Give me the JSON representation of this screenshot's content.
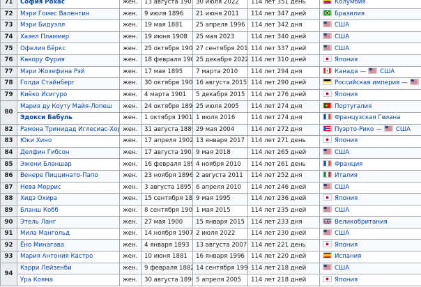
{
  "rows": [
    {
      "rank": "71",
      "name": "София Рохас",
      "bold": true,
      "sex": "жен.",
      "birth": "13 августа 1907",
      "death": "30 июля 2022",
      "age": "114 лет 351 день",
      "country": [
        {
          "flag": "colombia",
          "label": "Колумбия"
        }
      ]
    },
    {
      "rank": "72",
      "name": "Мэри Гомес Валентин",
      "sex": "жен.",
      "birth": "9 июля 1896",
      "death": "21 июня 2011",
      "age": "114 лет 347 дней",
      "country": [
        {
          "flag": "brazil",
          "label": "Бразилия"
        }
      ]
    },
    {
      "rank": "73",
      "name": "Мэри Бидуэлл",
      "sex": "жен.",
      "birth": "19 мая 1881",
      "death": "25 апреля 1996",
      "age": "114 лет 342 дня",
      "country": [
        {
          "flag": "usa",
          "label": "США"
        }
      ]
    },
    {
      "rank": "74",
      "name": "Хазел Пламмер",
      "sex": "жен.",
      "birth": "19 июня 1908",
      "death": "25 мая 2023",
      "age": "114 лет 340 дней",
      "country": [
        {
          "flag": "usa",
          "label": "США"
        }
      ]
    },
    {
      "rank": "75",
      "name": "Офелия Бёркс",
      "sex": "жен.",
      "birth": "25 октября 1903",
      "death": "27 сентября 2018",
      "age": "114 лет 337 дней",
      "country": [
        {
          "flag": "usa",
          "label": "США"
        }
      ]
    },
    {
      "rank": "76",
      "name": "Какору Фурия",
      "sex": "жен.",
      "birth": "18 февраля 1908",
      "death": "25 декабря 2022",
      "age": "114 лет 310 дней",
      "country": [
        {
          "flag": "japan",
          "label": "Япония"
        }
      ]
    },
    {
      "rank": "77",
      "name": "Мэри Жозефина Рэй",
      "sex": "жен.",
      "birth": "17 мая 1895",
      "death": "7 марта 2010",
      "age": "114 лет 294 дня",
      "country": [
        {
          "flag": "canada",
          "label": "Канада"
        },
        {
          "flag": "usa",
          "label": "США"
        }
      ]
    },
    {
      "rank": "78",
      "name": "Голди Стайнберг",
      "sex": "жен.",
      "birth": "30 октября 1900",
      "death": "16 августа 2015",
      "age": "114 лет 290 дней",
      "country": [
        {
          "flag": "russia",
          "label": "Российская империя"
        },
        {
          "flag": "usa",
          "label": "США"
        }
      ]
    },
    {
      "rank": "79",
      "name": "Киёко Исигуро",
      "sex": "жен.",
      "birth": "4 марта 1901",
      "death": "5 декабря 2015",
      "age": "114 лет 276 дней",
      "country": [
        {
          "flag": "japan",
          "label": "Япония"
        }
      ]
    },
    {
      "rank": "80",
      "name": "Мария ду Коуту Майя-Лопеш",
      "sex": "жен.",
      "birth": "24 октября 1890",
      "death": "25 июля 2005",
      "age": "114 лет 274 дня",
      "country": [
        {
          "flag": "portugal",
          "label": "Португалия"
        }
      ],
      "rowspan": 2
    },
    {
      "rank": "",
      "name": "Эдокси Бабуль",
      "bold": true,
      "sex": "жен.",
      "birth": "1 октября 1901",
      "death": "1 июля 2016",
      "age": "114 лет 274 дня",
      "country": [
        {
          "flag": "france",
          "label": "Французская Гвиана"
        }
      ],
      "cont": true
    },
    {
      "rank": "82",
      "name": "Рамона Тринидад Иглесиас-Хордан",
      "sex": "жен.",
      "birth": "31 августа 1889",
      "death": "29 мая 2004",
      "age": "114 лет 272 дня",
      "country": [
        {
          "flag": "puertorico",
          "label": "Пуэрто-Рико"
        },
        {
          "flag": "usa",
          "label": "США"
        }
      ]
    },
    {
      "rank": "83",
      "name": "Юки Хино",
      "sex": "жен.",
      "birth": "17 апреля 1902",
      "death": "13 января 2017",
      "age": "114 лет 271 день",
      "country": [
        {
          "flag": "japan",
          "label": "Япония"
        }
      ]
    },
    {
      "rank": "84",
      "name": "Делфин Гибсон",
      "sex": "жен.",
      "birth": "17 августа 1903",
      "death": "9 мая 2018",
      "age": "114 лет 265 дней",
      "country": [
        {
          "flag": "usa",
          "label": "США"
        }
      ]
    },
    {
      "rank": "85",
      "name": "Эжени Бланшар",
      "sex": "жен.",
      "birth": "16 февраля 1896",
      "death": "4 ноября 2010",
      "age": "114 лет 261 день",
      "country": [
        {
          "flag": "france",
          "label": "Франция"
        }
      ]
    },
    {
      "rank": "86",
      "name": "Венере Пиццинато-Папо",
      "sex": "жен.",
      "birth": "23 ноября 1896",
      "death": "2 августа 2011",
      "age": "114 лет 252 дня",
      "country": [
        {
          "flag": "italy",
          "label": "Италия"
        }
      ]
    },
    {
      "rank": "87",
      "name": "Нева Моррис",
      "sex": "жен.",
      "birth": "3 августа 1895",
      "death": "6 апреля 2010",
      "age": "114 лет 246 дней",
      "country": [
        {
          "flag": "usa",
          "label": "США"
        }
      ]
    },
    {
      "rank": "88",
      "name": "Хидэ Охира",
      "sex": "жен.",
      "birth": "15 сентября 1880",
      "death": "9 мая 1995",
      "age": "114 лет 236 дней",
      "country": [
        {
          "flag": "japan",
          "label": "Япония"
        }
      ]
    },
    {
      "rank": "89",
      "name": "Бланш Кобб",
      "sex": "жен.",
      "birth": "8 сентября 1900",
      "death": "1 мая 2015",
      "age": "114 лет 235 дней",
      "country": [
        {
          "flag": "usa",
          "label": "США"
        }
      ]
    },
    {
      "rank": "90",
      "name": "Этель Ланг",
      "sex": "жен.",
      "birth": "27 мая 1900",
      "death": "15 января 2015",
      "age": "114 лет 233 дня",
      "country": [
        {
          "flag": "uk",
          "label": "Великобритания"
        }
      ]
    },
    {
      "rank": "91",
      "name": "Мила Мангольд",
      "sex": "жен.",
      "birth": "14 ноября 1907",
      "death": "2 июля 2022",
      "age": "114 лет 230 дней",
      "country": [
        {
          "flag": "usa",
          "label": "США"
        }
      ]
    },
    {
      "rank": "92",
      "name": "Ёно Минагава",
      "sex": "жен.",
      "birth": "4 января 1893",
      "death": "13 августа 2007",
      "age": "114 лет 221 день",
      "country": [
        {
          "flag": "japan",
          "label": "Япония"
        }
      ]
    },
    {
      "rank": "93",
      "name": "Мария Антония Кастро",
      "sex": "жен.",
      "birth": "10 июня 1881",
      "death": "16 января 1996",
      "age": "114 лет 220 дней",
      "country": [
        {
          "flag": "spain",
          "label": "Испания"
        }
      ]
    },
    {
      "rank": "94",
      "name": "Кэрри Лейзенби",
      "sex": "жен.",
      "birth": "9 февраля 1882",
      "death": "14 сентября 1996",
      "age": "114 лет 218 дней",
      "country": [
        {
          "flag": "usa",
          "label": "США"
        }
      ],
      "rowspan": 2
    },
    {
      "rank": "",
      "name": "Ура Кояма",
      "sex": "жен.",
      "birth": "30 августа 1890",
      "death": "5 апреля 2005",
      "age": "114 лет 218 дней",
      "country": [
        {
          "flag": "japan",
          "label": "Япония"
        }
      ],
      "cont": true
    }
  ],
  "separator": "—",
  "flag_colors": {
    "usa": "#3c3b6e",
    "japan": "#bc002d",
    "france": "#0055a4",
    "italy": "#009246",
    "spain": "#c60b1e",
    "uk": "#012169",
    "brazil": "#009c3b",
    "colombia": "#fcd116",
    "canada": "#d52b1e",
    "russia": "#0039a6",
    "portugal": "#006600",
    "puertorico": "#ed0000"
  }
}
